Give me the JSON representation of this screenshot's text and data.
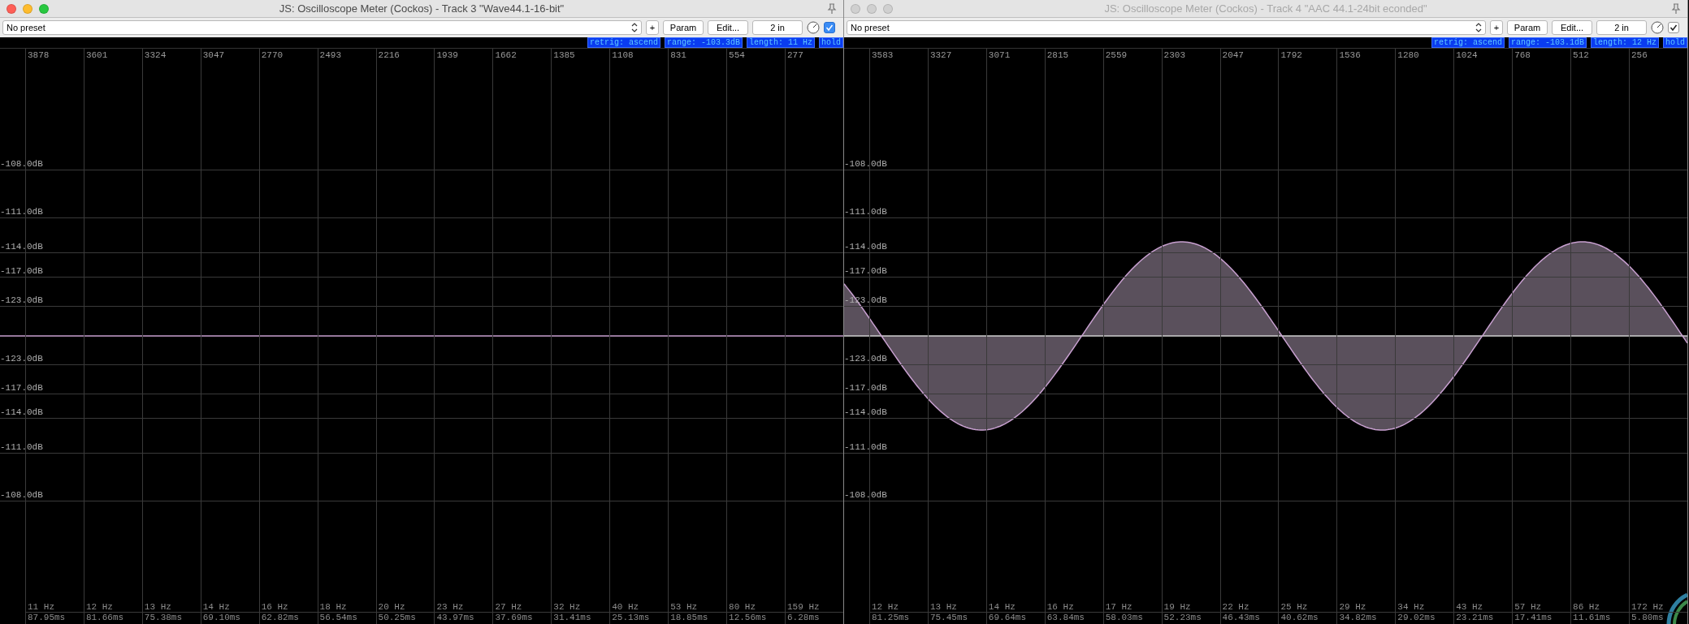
{
  "windows": [
    {
      "title": "JS: Oscilloscope Meter (Cockos) - Track 3 \"Wave44.1-16-bit\"",
      "active": true,
      "preset": "No preset",
      "buttons": [
        "+",
        "Param",
        "Edit...",
        "2 in"
      ],
      "checked": true,
      "status": [
        "retrig: ascend",
        "range: -103.3dB",
        "length: 11 Hz",
        "hold"
      ],
      "column_labels": [
        "3878",
        "3601",
        "3324",
        "3047",
        "2770",
        "2493",
        "2216",
        "1939",
        "1662",
        "1385",
        "1108",
        "831",
        "554",
        "277"
      ],
      "db_labels": [
        "-108.0dB",
        "-111.0dB",
        "-114.0dB",
        "-117.0dB",
        "-123.0dB",
        "-123.0dB",
        "-117.0dB",
        "-114.0dB",
        "-111.0dB",
        "-108.0dB"
      ],
      "bottom_labels": [
        {
          "hz": "11 Hz",
          "ms": "87.95ms"
        },
        {
          "hz": "12 Hz",
          "ms": "81.66ms"
        },
        {
          "hz": "13 Hz",
          "ms": "75.38ms"
        },
        {
          "hz": "14 Hz",
          "ms": "69.10ms"
        },
        {
          "hz": "16 Hz",
          "ms": "62.82ms"
        },
        {
          "hz": "18 Hz",
          "ms": "56.54ms"
        },
        {
          "hz": "20 Hz",
          "ms": "50.25ms"
        },
        {
          "hz": "23 Hz",
          "ms": "43.97ms"
        },
        {
          "hz": "27 Hz",
          "ms": "37.69ms"
        },
        {
          "hz": "32 Hz",
          "ms": "31.41ms"
        },
        {
          "hz": "40 Hz",
          "ms": "25.13ms"
        },
        {
          "hz": "53 Hz",
          "ms": "18.85ms"
        },
        {
          "hz": "80 Hz",
          "ms": "12.56ms"
        },
        {
          "hz": "159 Hz",
          "ms": "6.28ms"
        }
      ],
      "signal": {
        "kind": "flat"
      }
    },
    {
      "title": "JS: Oscilloscope Meter (Cockos) - Track 4 \"AAC 44.1-24bit econded\"",
      "active": false,
      "preset": "No preset",
      "buttons": [
        "+",
        "Param",
        "Edit...",
        "2 in"
      ],
      "checked": true,
      "status": [
        "retrig: ascend",
        "range: -103.1dB",
        "length: 12 Hz",
        "hold"
      ],
      "column_labels": [
        "3583",
        "3327",
        "3071",
        "2815",
        "2559",
        "2303",
        "2047",
        "1792",
        "1536",
        "1280",
        "1024",
        "768",
        "512",
        "256"
      ],
      "db_labels": [
        "-108.0dB",
        "-111.0dB",
        "-114.0dB",
        "-117.0dB",
        "-123.0dB",
        "-123.0dB",
        "-117.0dB",
        "-114.0dB",
        "-111.0dB",
        "-108.0dB"
      ],
      "bottom_labels": [
        {
          "hz": "12 Hz",
          "ms": "81.25ms"
        },
        {
          "hz": "13 Hz",
          "ms": "75.45ms"
        },
        {
          "hz": "14 Hz",
          "ms": "69.64ms"
        },
        {
          "hz": "16 Hz",
          "ms": "63.84ms"
        },
        {
          "hz": "17 Hz",
          "ms": "58.03ms"
        },
        {
          "hz": "19 Hz",
          "ms": "52.23ms"
        },
        {
          "hz": "22 Hz",
          "ms": "46.43ms"
        },
        {
          "hz": "25 Hz",
          "ms": "40.62ms"
        },
        {
          "hz": "29 Hz",
          "ms": "34.82ms"
        },
        {
          "hz": "34 Hz",
          "ms": "29.02ms"
        },
        {
          "hz": "43 Hz",
          "ms": "23.21ms"
        },
        {
          "hz": "57 Hz",
          "ms": "17.41ms"
        },
        {
          "hz": "86 Hz",
          "ms": "11.61ms"
        },
        {
          "hz": "172 Hz",
          "ms": "5.80ms"
        }
      ],
      "signal": {
        "kind": "sine"
      }
    }
  ]
}
